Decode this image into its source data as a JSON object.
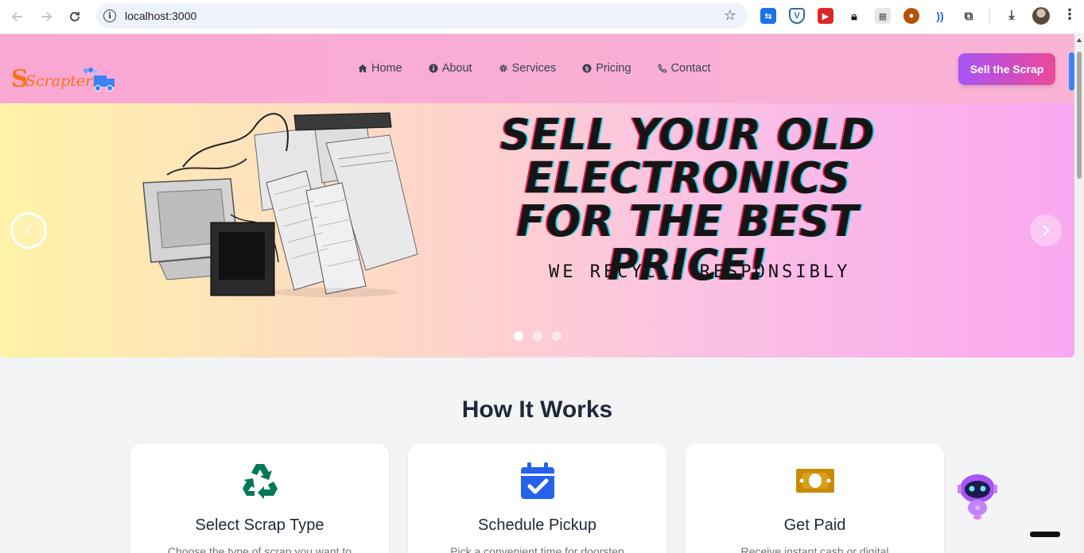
{
  "browser": {
    "url": "localhost:3000",
    "icons": [
      "back-icon",
      "forward-icon",
      "reload-icon",
      "site-info-icon",
      "bookmark-star-icon",
      "extensions-icon",
      "download-icon",
      "menu-icon"
    ]
  },
  "nav": {
    "logo_text": "Scrapters",
    "items": [
      {
        "label": "Home",
        "icon": "home-icon"
      },
      {
        "label": "About",
        "icon": "info-icon"
      },
      {
        "label": "Services",
        "icon": "gear-icon"
      },
      {
        "label": "Pricing",
        "icon": "dollar-icon"
      },
      {
        "label": "Contact",
        "icon": "phone-icon"
      }
    ],
    "cta_label": "Sell the Scrap"
  },
  "hero": {
    "headline": "SELL YOUR OLD ELECTRONICS FOR THE BEST PRICE!",
    "tagline": "WE RECYCLE RESPONSIBLY",
    "slides_count": 3,
    "active_slide": 1
  },
  "how_it_works": {
    "title": "How It Works",
    "steps": [
      {
        "title": "Select Scrap Type",
        "desc": "Choose the type of scrap you want to",
        "icon": "recycle-icon",
        "color": "#047857"
      },
      {
        "title": "Schedule Pickup",
        "desc": "Pick a convenient time for doorstep",
        "icon": "calendar-check-icon",
        "color": "#2563eb"
      },
      {
        "title": "Get Paid",
        "desc": "Receive instant cash or digital",
        "icon": "money-icon",
        "color": "#ca8a04"
      }
    ]
  },
  "colors": {
    "header_bg": "#f9a8d4",
    "cta_gradient_start": "#a855f7",
    "cta_gradient_end": "#ec4899"
  }
}
